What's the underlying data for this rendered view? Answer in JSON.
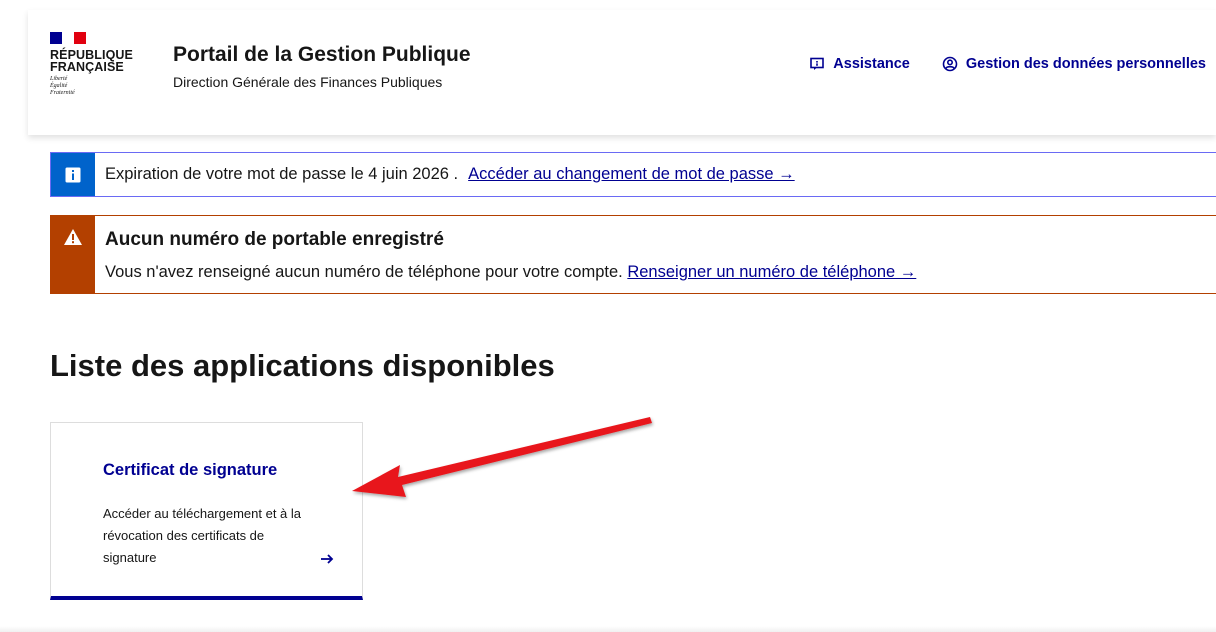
{
  "header": {
    "brand_line1": "RÉPUBLIQUE",
    "brand_line2": "FRANÇAISE",
    "motto": [
      "Liberté",
      "Égalité",
      "Fraternité"
    ],
    "service_title": "Portail de la Gestion Publique",
    "service_tagline": "Direction Générale des Finances Publiques",
    "tools": {
      "assistance_label": "Assistance",
      "personal_data_label": "Gestion des données personnelles"
    }
  },
  "notices": {
    "info": {
      "text": "Expiration de votre mot de passe le 4 juin 2026 .",
      "link": "Accéder au changement de mot de passe →",
      "color": "#0063cb"
    },
    "warning": {
      "title": "Aucun numéro de portable enregistré",
      "text": "Vous n'avez renseigné aucun numéro de téléphone pour votre compte.",
      "link": "Renseigner un numéro de téléphone →",
      "color": "#b34000"
    }
  },
  "main": {
    "section_title": "Liste des applications disponibles",
    "tiles": [
      {
        "title": "Certificat de signature",
        "description": "Accéder au téléchargement et à la révocation des certificats de signature",
        "icon": "arrow-right-icon"
      }
    ]
  },
  "colors": {
    "accent": "#000091",
    "annotation": "#e8161b"
  }
}
